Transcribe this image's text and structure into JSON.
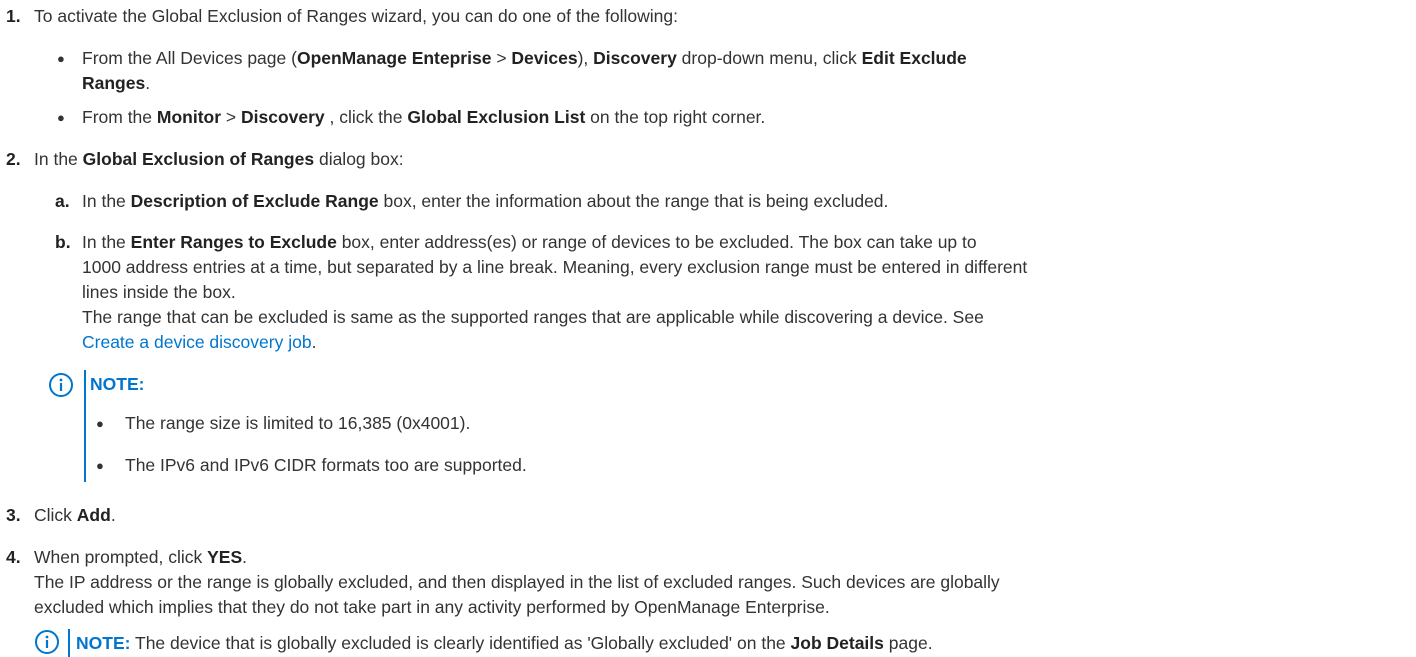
{
  "step1": {
    "num": "1.",
    "text": "To activate the Global Exclusion of Ranges wizard, you can do one of the following:",
    "bullet1": {
      "t1": "From the All Devices page (",
      "b1": "OpenManage Enteprise",
      "t2": " > ",
      "b2": "Devices",
      "t3": "), ",
      "b3": "Discovery",
      "t4": " drop-down menu, click ",
      "b4": "Edit Exclude",
      "b5": "Ranges",
      "t5": "."
    },
    "bullet2": {
      "t1": "From the ",
      "b1": "Monitor",
      "t2": " > ",
      "b2": "Discovery",
      "t3": " , click the ",
      "b3": "Global Exclusion List",
      "t4": " on the top right corner."
    }
  },
  "step2": {
    "num": "2.",
    "t1": "In the ",
    "b1": "Global Exclusion of Ranges",
    "t2": " dialog box:",
    "sub_a": {
      "letter": "a.",
      "t1": "In the ",
      "b1": "Description of Exclude Range",
      "t2": " box, enter the information about the range that is being excluded."
    },
    "sub_b": {
      "letter": "b.",
      "t1": "In the ",
      "b1": "Enter Ranges to Exclude",
      "t2": " box, enter address(es) or range of devices to be excluded. The box can take up to",
      "line2": "1000 address entries at a time, but separated by a line break. Meaning, every exclusion range must be entered in different",
      "line3": "lines inside the box.",
      "line4": "The range that can be excluded is same as the supported ranges that are applicable while discovering a device. See",
      "link": "Create a device discovery job",
      "after_link": "."
    },
    "note": {
      "label": "NOTE:",
      "items": [
        "The range size is limited to 16,385 (0x4001).",
        "The IPv6 and IPv6 CIDR formats too are supported."
      ]
    }
  },
  "step3": {
    "num": "3.",
    "t1": "Click ",
    "b1": "Add",
    "t2": "."
  },
  "step4": {
    "num": "4.",
    "t1": "When prompted, click ",
    "b1": "YES",
    "t2": ".",
    "line2": "The IP address or the range is globally excluded, and then displayed in the list of excluded ranges. Such devices are globally",
    "line3": "excluded which implies that they do not take part in any activity performed by OpenManage Enterprise.",
    "note": {
      "label": "NOTE:",
      "t1": " The device that is globally excluded is clearly identified as 'Globally excluded' on the ",
      "b1": "Job Details",
      "t2": " page."
    }
  },
  "icons": {
    "note_icon": "info-circle-icon"
  },
  "colors": {
    "accent": "#0076ce",
    "text": "#333333"
  }
}
